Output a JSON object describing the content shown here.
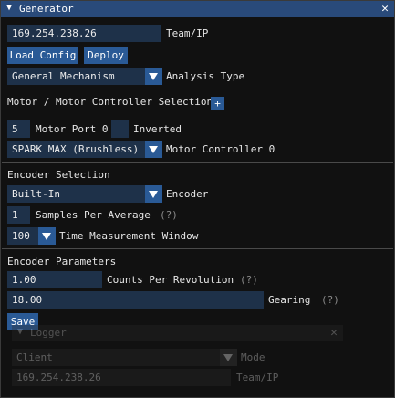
{
  "window": {
    "title": "Generator"
  },
  "team_ip": {
    "value": "169.254.238.26",
    "label": "Team/IP"
  },
  "buttons": {
    "load_config": "Load Config",
    "deploy": "Deploy",
    "save": "Save"
  },
  "analysis": {
    "value": "General Mechanism",
    "label": "Analysis Type"
  },
  "motor": {
    "heading": "Motor / Motor Controller Selection",
    "add_symbol": "+",
    "port_value": "5",
    "port_label": "Motor Port 0",
    "inverted_label": "Inverted",
    "controller_value": "SPARK MAX (Brushless)",
    "controller_label": "Motor Controller 0"
  },
  "encoder": {
    "heading": "Encoder Selection",
    "value": "Built-In",
    "label": "Encoder",
    "samples_value": "1",
    "samples_label": "Samples Per Average",
    "samples_help": "(?)",
    "window_value": "100",
    "window_label": "Time Measurement Window"
  },
  "params": {
    "heading": "Encoder Parameters",
    "cpr_value": "1.00",
    "cpr_label": "Counts Per Revolution",
    "cpr_help": "(?)",
    "gearing_value": "18.00",
    "gearing_label": "Gearing",
    "gearing_help": "(?)"
  },
  "logger": {
    "title": "Logger",
    "mode_value": "Client",
    "mode_label": "Mode",
    "ip_value": "169.254.238.26",
    "ip_label": "Team/IP"
  },
  "colors": {
    "titlebar": "#294a7a",
    "button": "#2a5a96",
    "field": "#1e3149"
  },
  "icons": {
    "collapse": "triangle-down",
    "close": "x-close",
    "dropdown": "triangle-down"
  }
}
